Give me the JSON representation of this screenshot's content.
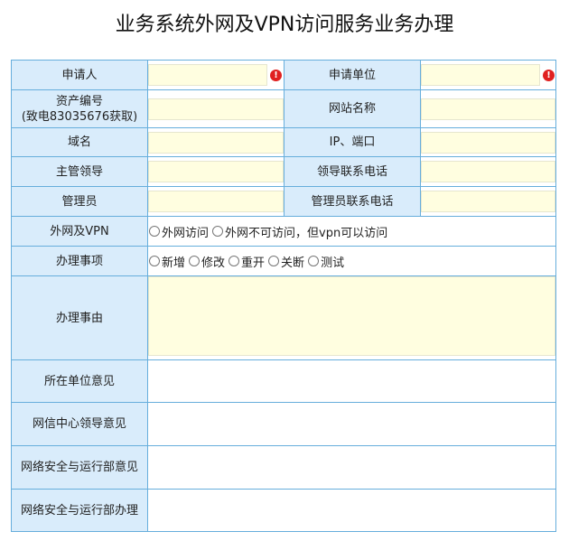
{
  "page_title": "业务系统外网及VPN访问服务业务办理",
  "form": {
    "applicant_label": "申请人",
    "applicant_value": "",
    "applicant_unit_label": "申请单位",
    "applicant_unit_value": "",
    "asset_no_label_line1": "资产编号",
    "asset_no_label_line2": "(致电83035676获取)",
    "asset_no_value": "",
    "site_name_label": "网站名称",
    "site_name_value": "",
    "domain_label": "域名",
    "domain_value": "",
    "ip_port_label": "IP、端口",
    "ip_port_value": "",
    "supervisor_label": "主管领导",
    "supervisor_value": "",
    "leader_phone_label": "领导联系电话",
    "leader_phone_value": "",
    "admin_label": "管理员",
    "admin_value": "",
    "admin_phone_label": "管理员联系电话",
    "admin_phone_value": "",
    "external_vpn_label": "外网及VPN",
    "external_vpn_options": [
      "外网访问",
      "外网不可访问，但vpn可以访问"
    ],
    "matter_label": "办理事项",
    "matter_options": [
      "新增",
      "修改",
      "重开",
      "关断",
      "测试"
    ],
    "reason_label": "办理事由",
    "reason_value": "",
    "unit_opinion_label": "所在单位意见",
    "center_leader_opinion_label": "网信中心领导意见",
    "security_dept_opinion_label": "网络安全与运行部意见",
    "security_dept_handle_label": "网络安全与运行部办理"
  },
  "colors": {
    "label_bg": "#d9ecfb",
    "border": "#66aedc",
    "input_bg": "#fffee0",
    "required_icon": "#e02020"
  },
  "icons": {
    "required": "exclamation-circle-icon"
  }
}
